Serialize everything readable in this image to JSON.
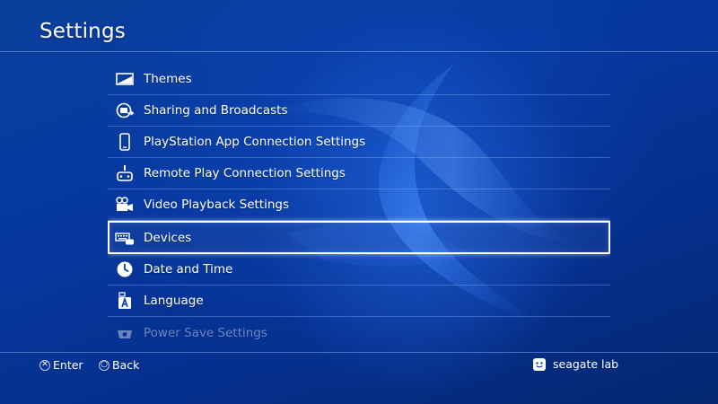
{
  "header": {
    "title": "Settings"
  },
  "menu": {
    "items": [
      {
        "label": "Themes",
        "icon": "themes-icon"
      },
      {
        "label": "Sharing and Broadcasts",
        "icon": "sharing-icon"
      },
      {
        "label": "PlayStation App Connection Settings",
        "icon": "phone-icon"
      },
      {
        "label": "Remote Play Connection Settings",
        "icon": "remote-play-icon"
      },
      {
        "label": "Video Playback Settings",
        "icon": "video-playback-icon"
      },
      {
        "label": "Devices",
        "icon": "devices-icon",
        "selected": true
      },
      {
        "label": "Date and Time",
        "icon": "clock-icon"
      },
      {
        "label": "Language",
        "icon": "language-icon"
      },
      {
        "label": "Power Save Settings",
        "icon": "power-save-icon",
        "faded": true
      }
    ]
  },
  "footer": {
    "enter_label": "Enter",
    "enter_glyph": "✕",
    "back_label": "Back",
    "back_glyph": "○",
    "user_name": "seagate lab"
  },
  "colors": {
    "background": "#0639a0",
    "text": "#ffffff",
    "selection_border": "#ffffff"
  }
}
